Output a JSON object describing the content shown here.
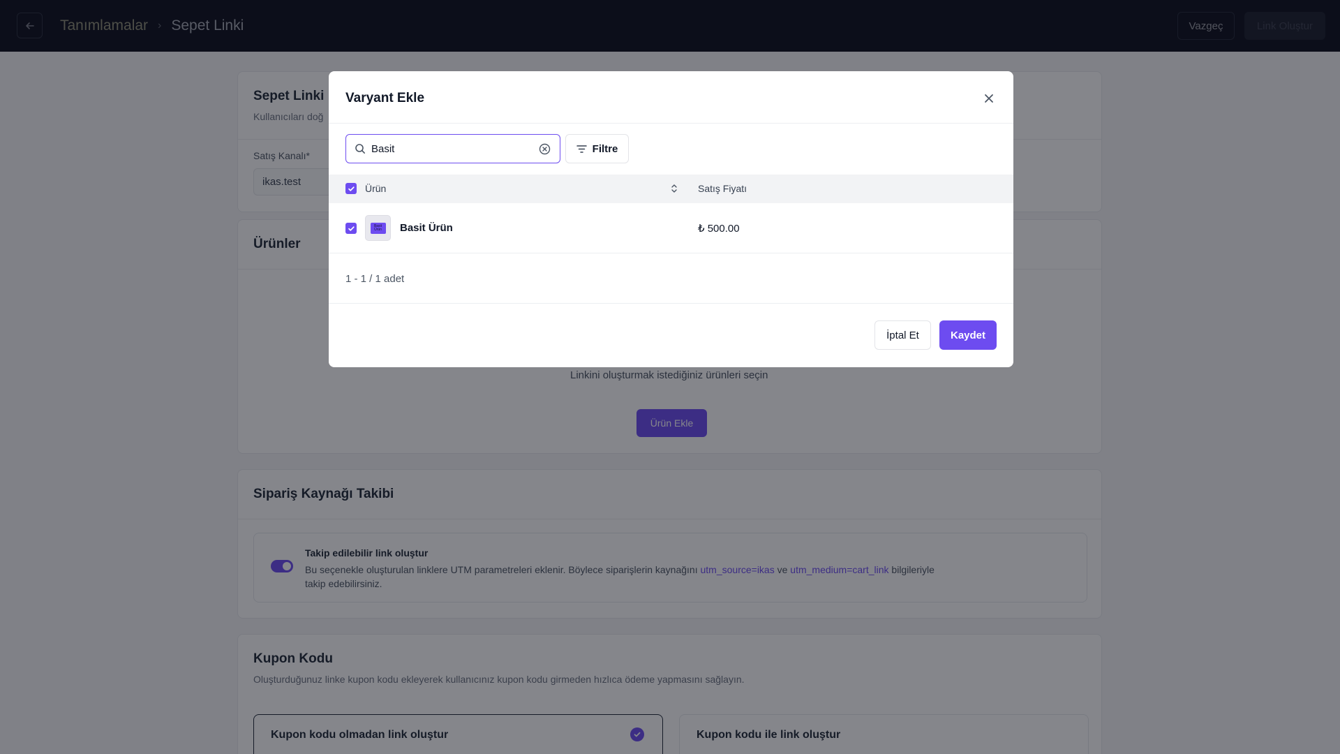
{
  "header": {
    "breadcrumb_parent": "Tanımlamalar",
    "breadcrumb_separator": "›",
    "breadcrumb_current": "Sepet Linki",
    "cancel_label": "Vazgeç",
    "create_label": "Link Oluştur"
  },
  "background": {
    "link_card": {
      "title": "Sepet Linki",
      "description": "Kullanıcıları doğ",
      "channel_label": "Satış Kanalı*",
      "channel_value": "ikas.test"
    },
    "products_card": {
      "title": "Ürünler",
      "empty_text": "Linkini oluşturmak istediğiniz ürünleri seçin",
      "add_button": "Ürün Ekle"
    },
    "tracking_card": {
      "title": "Sipariş Kaynağı Takibi",
      "toggle_title": "Takip edilebilir link oluştur",
      "desc_before": "Bu seçenekle oluşturulan linklere UTM parametreleri eklenir. Böylece siparişlerin kaynağını",
      "utm_source": "utm_source=ikas",
      "desc_and": "ve",
      "utm_medium": "utm_medium=cart_link",
      "desc_after": "bilgileriyle",
      "desc_line2": "takip edebilirsiniz."
    },
    "coupon_card": {
      "title": "Kupon Kodu",
      "description": "Oluşturduğunuz linke kupon kodu ekleyerek kullanıcınız kupon kodu girmeden hızlıca ödeme yapmasını sağlayın.",
      "option_without": "Kupon kodu olmadan link oluştur",
      "option_with": "Kupon kodu ile link oluştur"
    }
  },
  "modal": {
    "title": "Varyant Ekle",
    "search_value": "Basit",
    "filter_label": "Filtre",
    "table": {
      "columns": [
        "Ürün",
        "Satış Fiyatı"
      ],
      "rows": [
        {
          "name": "Basit Ürün",
          "thumb_text": "Basit Ürün",
          "price": "₺ 500.00",
          "selected": true
        }
      ]
    },
    "pagination": "1 - 1 / 1 adet",
    "cancel_label": "İptal Et",
    "save_label": "Kaydet"
  },
  "colors": {
    "accent": "#6d4cf0",
    "topbar": "#0c0f1c"
  }
}
